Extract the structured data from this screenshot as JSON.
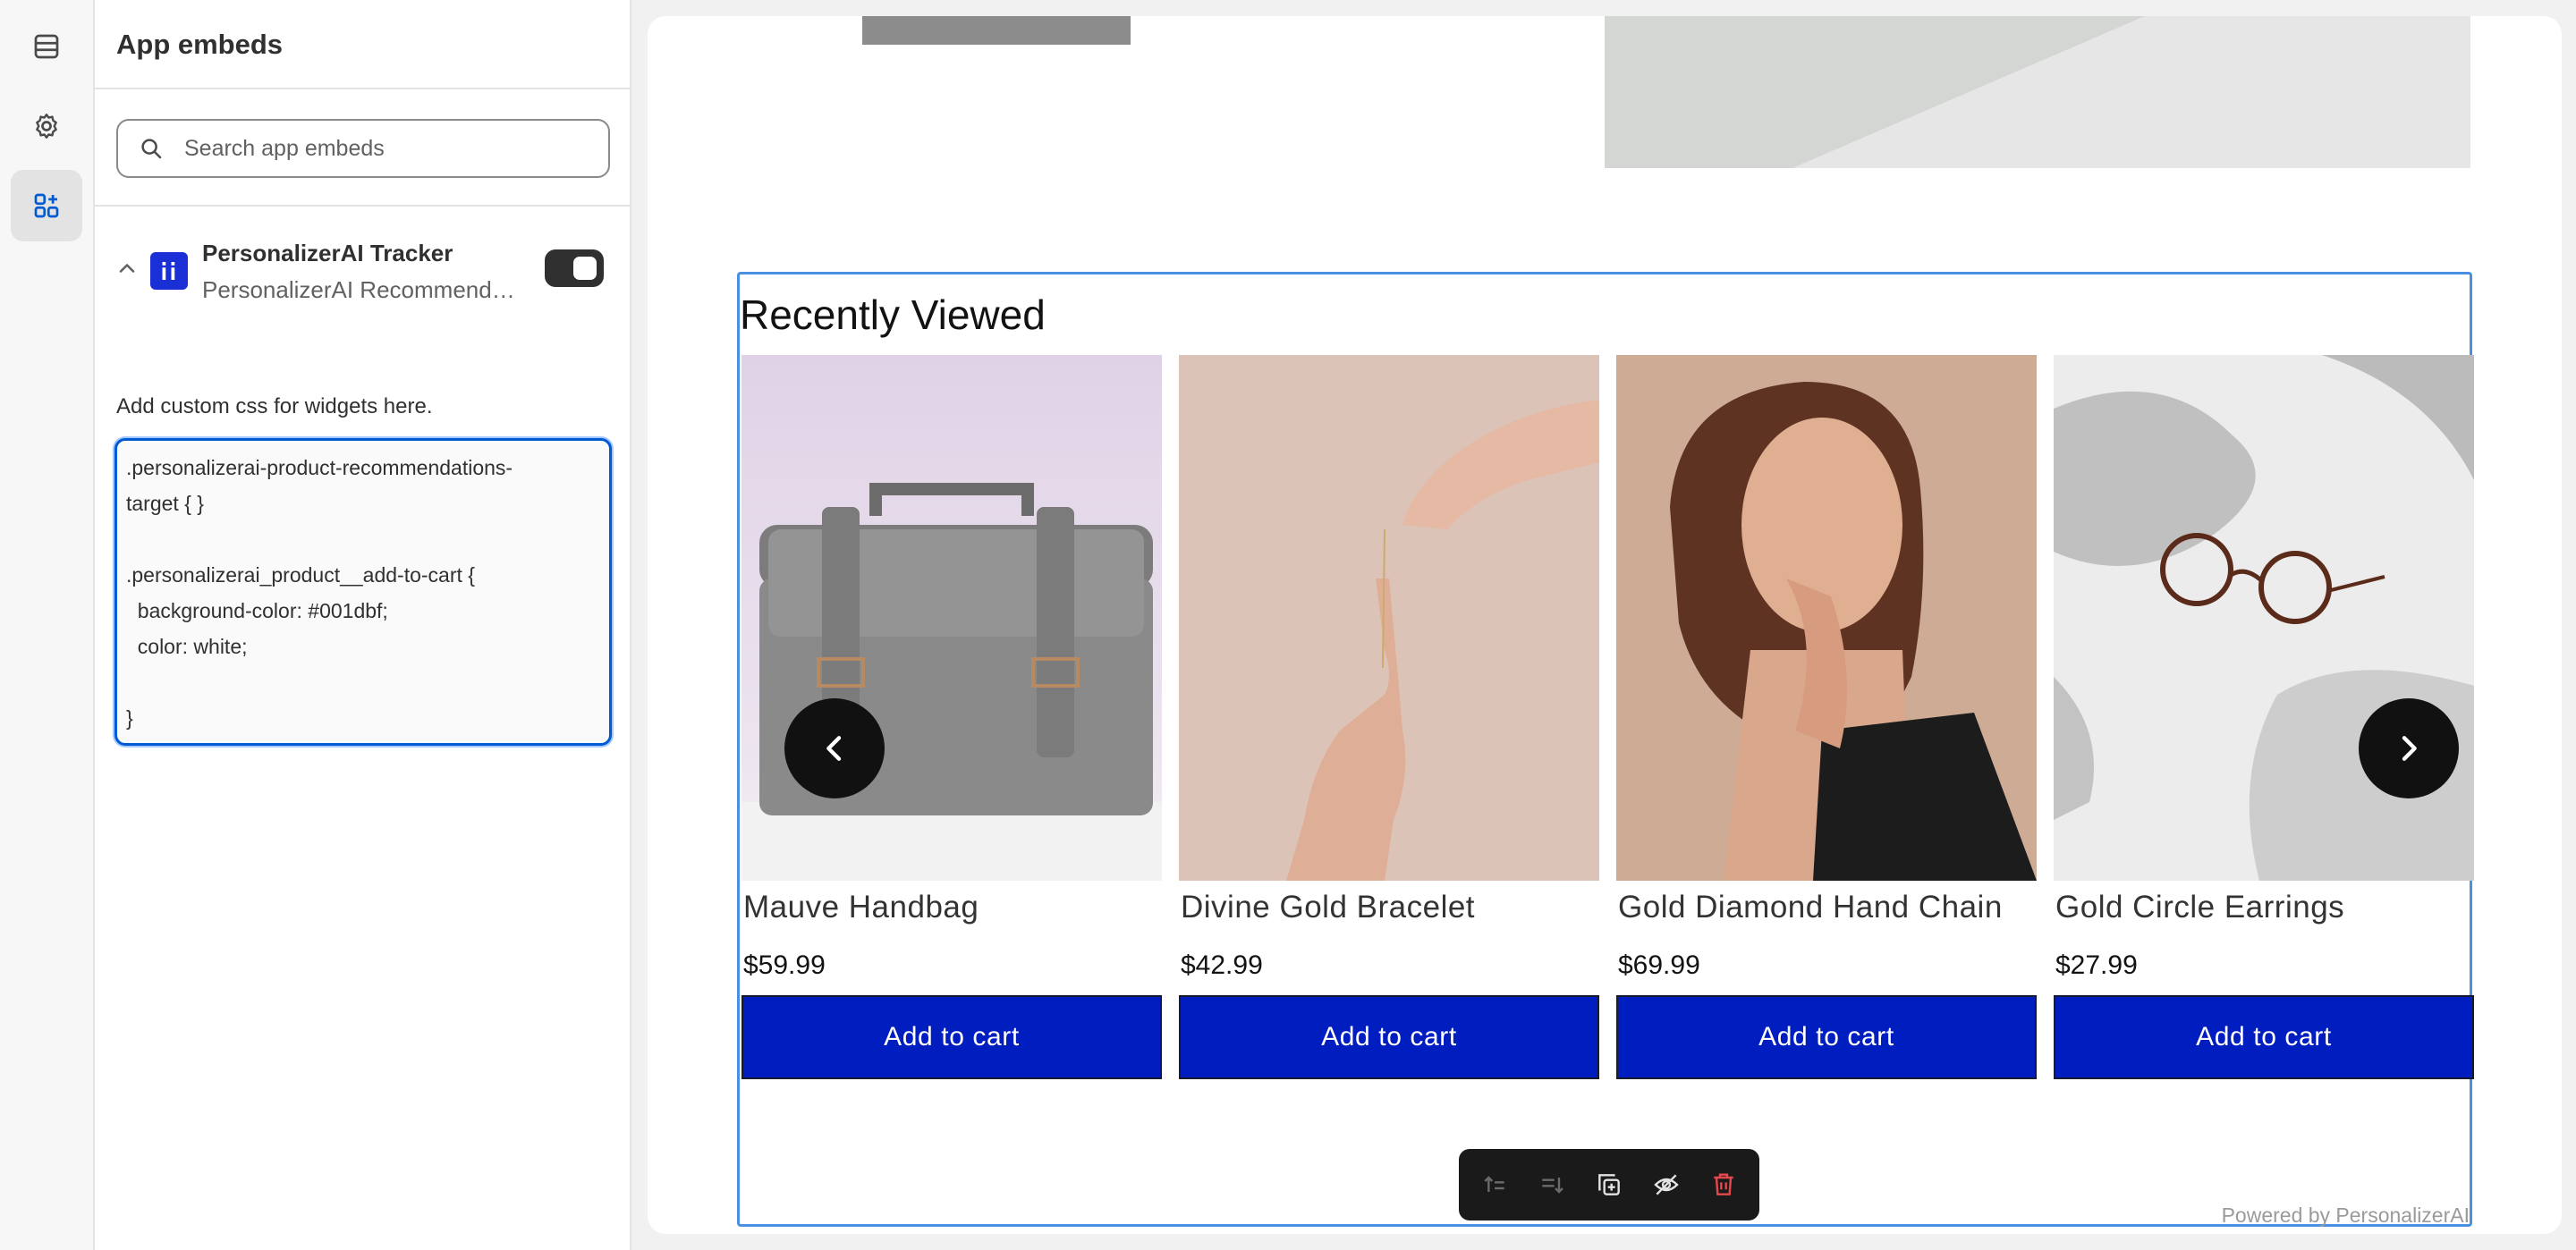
{
  "rail": {
    "items": [
      {
        "icon": "sections-icon",
        "active": false
      },
      {
        "icon": "gear-icon",
        "active": false
      },
      {
        "icon": "app-embeds-icon",
        "active": true
      }
    ]
  },
  "panel": {
    "title": "App embeds",
    "search": {
      "placeholder": "Search app embeds",
      "value": ""
    },
    "embed": {
      "name": "PersonalizerAI Tracker",
      "subtitle": "PersonalizerAI Recommendations",
      "enabled": true
    },
    "css_label": "Add custom css for widgets here.",
    "css_value": ".personalizerai-product-recommendations-\ntarget { }\n\n.personalizerai_product__add-to-cart {\n  background-color: #001dbf;\n  color: white;\n\n}"
  },
  "preview": {
    "section_title": "Recently Viewed",
    "products": [
      {
        "title": "Mauve Handbag",
        "price": "$59.99",
        "button": "Add to cart",
        "image": "handbag"
      },
      {
        "title": "Divine Gold Bracelet",
        "price": "$42.99",
        "button": "Add to cart",
        "image": "bracelet"
      },
      {
        "title": "Gold Diamond Hand Chain",
        "price": "$69.99",
        "button": "Add to cart",
        "image": "portrait"
      },
      {
        "title": "Gold Circle Earrings",
        "price": "$27.99",
        "button": "Add to cart",
        "image": "glasses"
      }
    ],
    "powered_by": "Powered by PersonalizerAI",
    "button_color": "#001dbf",
    "toolbar": [
      "move-up-icon",
      "move-down-icon",
      "duplicate-icon",
      "hide-icon",
      "delete-icon"
    ]
  }
}
